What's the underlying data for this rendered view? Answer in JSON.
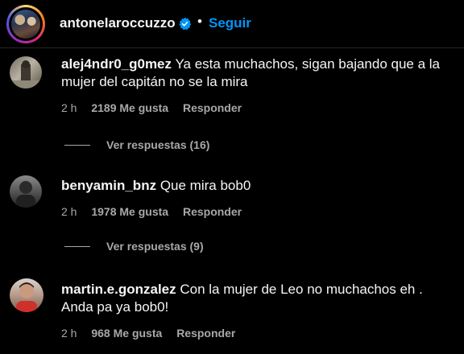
{
  "header": {
    "username": "antonelaroccuzzo",
    "dot": "•",
    "follow_label": "Seguir",
    "verified_icon": "verified-badge-icon",
    "accent_color": "#0095f6"
  },
  "comments": [
    {
      "username": "alej4ndr0_g0mez",
      "text": "Ya esta muchachos, sigan bajando que a la mujer del capitán no se la mira",
      "time": "2 h",
      "likes": "2189 Me gusta",
      "reply_label": "Responder",
      "view_replies": "Ver respuestas (16)"
    },
    {
      "username": "benyamin_bnz",
      "text": "Que mira bob0",
      "time": "2 h",
      "likes": "1978 Me gusta",
      "reply_label": "Responder",
      "view_replies": "Ver respuestas (9)"
    },
    {
      "username": "martin.e.gonzalez",
      "text": "Con la mujer de Leo no muchachos eh . Anda pa ya bob0!",
      "time": "2 h",
      "likes": "968 Me gusta",
      "reply_label": "Responder"
    }
  ]
}
